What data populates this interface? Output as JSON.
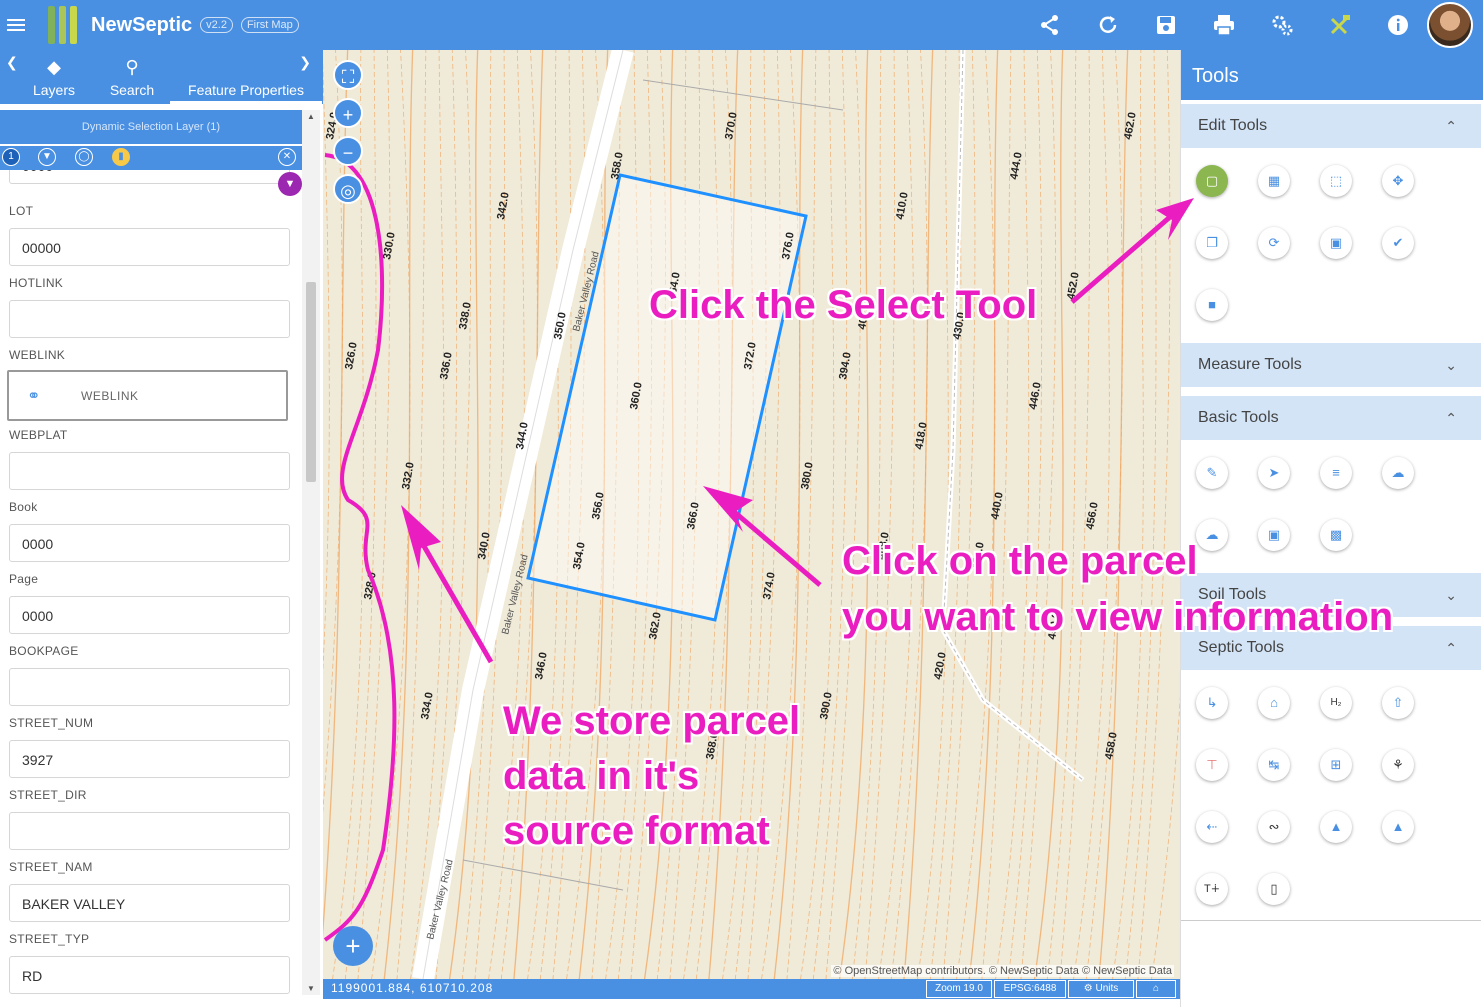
{
  "app": {
    "brand": "NewSeptic",
    "version": "v2.2",
    "map_name": "First Map"
  },
  "topbar": {
    "icons": [
      "share-icon",
      "refresh-icon",
      "save-icon",
      "print-icon",
      "settings-icon",
      "tools-icon",
      "info-icon"
    ]
  },
  "left_tabs": {
    "layers": "Layers",
    "search": "Search",
    "feature_properties": "Feature Properties"
  },
  "selection": {
    "header": "Dynamic Selection Layer (1)",
    "count_badge": "1"
  },
  "form": {
    "partial_value": "0000",
    "fields": [
      {
        "label": "LOT",
        "value": "00000"
      },
      {
        "label": "HOTLINK",
        "value": ""
      },
      {
        "label": "WEBLINK",
        "value": "WEBLINK"
      },
      {
        "label": "WEBPLAT",
        "value": ""
      },
      {
        "label": "Book",
        "value": "0000"
      },
      {
        "label": "Page",
        "value": "0000"
      },
      {
        "label": "BOOKPAGE",
        "value": ""
      },
      {
        "label": "STREET_NUM",
        "value": "3927"
      },
      {
        "label": "STREET_DIR",
        "value": ""
      },
      {
        "label": "STREET_NAM",
        "value": "BAKER VALLEY"
      },
      {
        "label": "STREET_TYP",
        "value": "RD"
      }
    ]
  },
  "map": {
    "road_label": "Baker Valley Road",
    "attribution": "© OpenStreetMap contributors. © NewSeptic Data © NewSeptic Data",
    "coordinates": "1199001.884, 610710.208",
    "zoom": "Zoom 19.0",
    "epsg": "EPSG:6488",
    "units": "Units",
    "contour_labels": [
      "324.0",
      "326.0",
      "328.0",
      "330.0",
      "332.0",
      "334.0",
      "336.0",
      "338.0",
      "340.0",
      "342.0",
      "344.0",
      "346.0",
      "350.0",
      "354.0",
      "356.0",
      "358.0",
      "360.0",
      "362.0",
      "364.0",
      "366.0",
      "368.0",
      "370.0",
      "372.0",
      "374.0",
      "376.0",
      "380.0",
      "390.0",
      "394.0",
      "400.0",
      "408.0",
      "410.0",
      "418.0",
      "420.0",
      "430.0",
      "434.0",
      "440.0",
      "444.0",
      "446.0",
      "450.0",
      "452.0",
      "456.0",
      "458.0",
      "462.0"
    ]
  },
  "annotations": {
    "select_tool": "Click the Select Tool",
    "parcel_line1": "Click on the parcel",
    "parcel_line2": "you want to view information",
    "store_line1": "We store parcel",
    "store_line2": "data in it's",
    "store_line3": "source format"
  },
  "colors": {
    "primary": "#4a90e2",
    "section_bg": "#d3e4f7",
    "annotation": "#ea1ec0",
    "parcel_outline": "#1e90ff",
    "contour": "#f0a560",
    "select_active": "#8bb650"
  },
  "tools": {
    "title": "Tools",
    "sections": {
      "edit": "Edit Tools",
      "measure": "Measure Tools",
      "basic": "Basic Tools",
      "soil": "Soil Tools",
      "septic": "Septic Tools"
    },
    "edit_tools": [
      "select-icon",
      "select-box-icon",
      "select-area-icon",
      "move-icon",
      "copy-icon",
      "rotate-icon",
      "resize-icon",
      "style-icon",
      "delete-icon"
    ],
    "basic_tools": [
      "pencil-icon",
      "cursor-edit-icon",
      "edit-text-icon",
      "upload-icon",
      "download-icon",
      "import-icon",
      "frame-icon"
    ],
    "septic_tools": [
      "pipe-icon",
      "house-icon",
      "h2s-icon",
      "pump-icon",
      "tank-icon",
      "distance-icon",
      "add-grid-icon",
      "tree-icon",
      "flow-icon",
      "trench-icon",
      "station-icon",
      "triangle-icon",
      "text-size-icon",
      "folder-icon"
    ]
  }
}
